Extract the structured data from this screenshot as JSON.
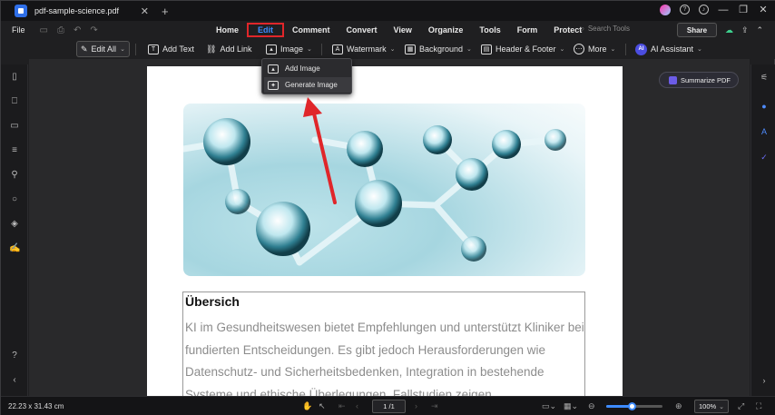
{
  "titlebar": {
    "doc_tab": "pdf-sample-science.pdf",
    "close": "✕",
    "add_tab": "+",
    "help": "?",
    "bell": "♪",
    "minimize": "—",
    "maximize": "❐",
    "close_window": "✕"
  },
  "menubar": {
    "file": "File",
    "items": [
      "Home",
      "Edit",
      "Comment",
      "Convert",
      "View",
      "Organize",
      "Tools",
      "Form",
      "Protect"
    ],
    "active": "Edit",
    "search_placeholder": "Search Tools",
    "share": "Share"
  },
  "toolbar": {
    "edit_all": "Edit All",
    "add_text": "Add Text",
    "add_link": "Add Link",
    "image": "Image",
    "watermark": "Watermark",
    "background": "Background",
    "header_footer": "Header & Footer",
    "more": "More",
    "ai_badge": "AI",
    "ai_assistant": "AI Assistant"
  },
  "dropdown": {
    "add_image": "Add Image",
    "generate_image": "Generate Image"
  },
  "summarize": "Summarize PDF",
  "page": {
    "heading": "Übersich",
    "paragraph": "KI im Gesundheitswesen bietet Empfehlungen und unterstützt Kliniker bei fundierten Entscheidungen.   Es gibt jedoch Herausforderungen wie Datenschutz- und Sicherheitsbedenken, Integration in bestehende Systeme und ethische Überlegungen. Fallstudien zeigen"
  },
  "statusbar": {
    "page_size": "22.23 x 31.43 cm",
    "page_indicator": "1 /1",
    "zoom": "100%",
    "zoom_level": 0.45
  },
  "colors": {
    "accent": "#3d8bff",
    "highlight_box": "#e0262a",
    "arrow": "#e0262a"
  }
}
